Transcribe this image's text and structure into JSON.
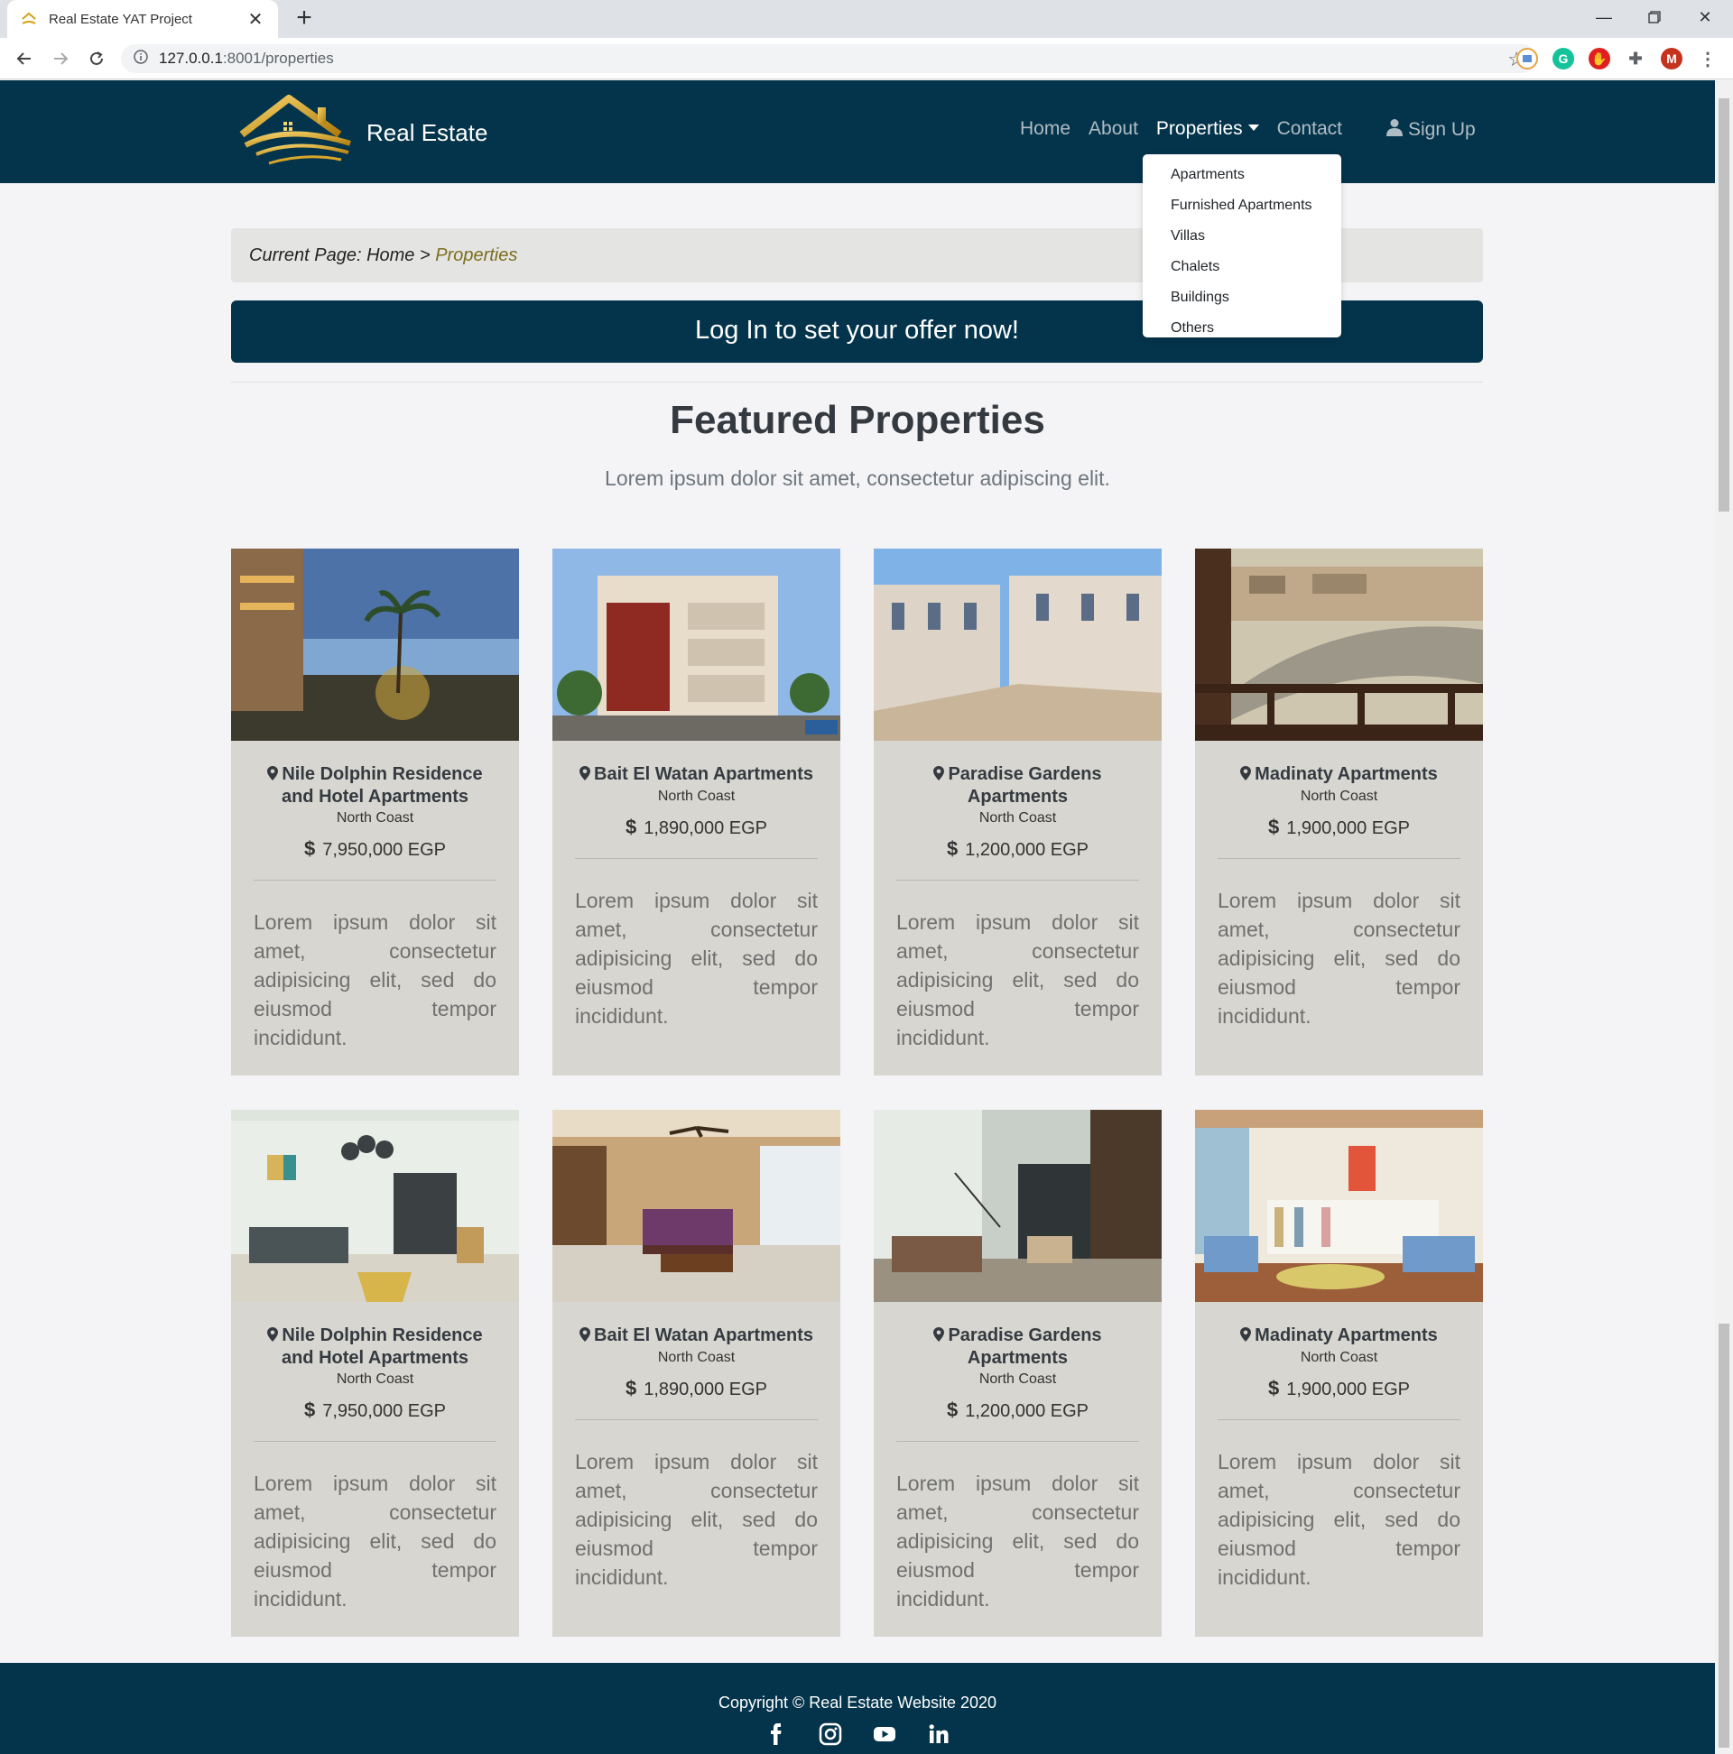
{
  "browser": {
    "tab_title": "Real Estate YAT Project",
    "url_host": "127.0.0.1",
    "url_rest": ":8001/properties",
    "avatar_letter": "M"
  },
  "nav": {
    "brand": "Real Estate",
    "links": [
      "Home",
      "About",
      "Properties",
      "Contact"
    ],
    "signup": "Sign Up",
    "dropdown": [
      "Apartments",
      "Furnished Apartments",
      "Villas",
      "Chalets",
      "Buildings",
      "Others"
    ]
  },
  "breadcrumb": {
    "prefix": "Current Page: Home > ",
    "current": "Properties"
  },
  "offer_banner": "Log In to set your offer now!",
  "section": {
    "title": "Featured Properties",
    "subtitle": "Lorem ipsum dolor sit amet, consectetur adipiscing elit."
  },
  "cards": [
    {
      "title": "Nile Dolphin Residence and Hotel Apartments",
      "location": "North Coast",
      "price": "7,950,000 EGP",
      "desc": "Lorem ipsum dolor sit amet, consectetur adipisicing elit, sed do eiusmod tempor incididunt.",
      "image": "night-waterfront-palms"
    },
    {
      "title": "Bait El Watan Apartments",
      "location": "North Coast",
      "price": "1,890,000 EGP",
      "desc": "Lorem ipsum dolor sit amet, consectetur adipisicing elit, sed do eiusmod tempor incididunt.",
      "image": "ornate-building"
    },
    {
      "title": "Paradise Gardens Apartments",
      "location": "North Coast",
      "price": "1,200,000 EGP",
      "desc": "Lorem ipsum dolor sit amet, consectetur adipisicing elit, sed do eiusmod tempor incididunt.",
      "image": "apartment-blocks"
    },
    {
      "title": "Madinaty Apartments",
      "location": "North Coast",
      "price": "1,900,000 EGP",
      "desc": "Lorem ipsum dolor sit amet, consectetur adipisicing elit, sed do eiusmod tempor incididunt.",
      "image": "balcony-street-view"
    },
    {
      "title": "Nile Dolphin Residence and Hotel Apartments",
      "location": "North Coast",
      "price": "7,950,000 EGP",
      "desc": "Lorem ipsum dolor sit amet, consectetur adipisicing elit, sed do eiusmod tempor incididunt.",
      "image": "modern-living-room"
    },
    {
      "title": "Bait El Watan Apartments",
      "location": "North Coast",
      "price": "1,890,000 EGP",
      "desc": "Lorem ipsum dolor sit amet, consectetur adipisicing elit, sed do eiusmod tempor incididunt.",
      "image": "hotel-lounge"
    },
    {
      "title": "Paradise Gardens Apartments",
      "location": "North Coast",
      "price": "1,200,000 EGP",
      "desc": "Lorem ipsum dolor sit amet, consectetur adipisicing elit, sed do eiusmod tempor incididunt.",
      "image": "loft-interior"
    },
    {
      "title": "Madinaty Apartments",
      "location": "North Coast",
      "price": "1,900,000 EGP",
      "desc": "Lorem ipsum dolor sit amet, consectetur adipisicing elit, sed do eiusmod tempor incididunt.",
      "image": "blue-sofa-living-room"
    }
  ],
  "footer": {
    "copyright": "Copyright © Real Estate Website 2020",
    "socials": [
      "facebook-icon",
      "instagram-icon",
      "youtube-icon",
      "linkedin-icon"
    ]
  },
  "colors": {
    "navy": "#04344b",
    "card_bg": "#d7d6d0",
    "page_bg": "#f4f4f6"
  }
}
